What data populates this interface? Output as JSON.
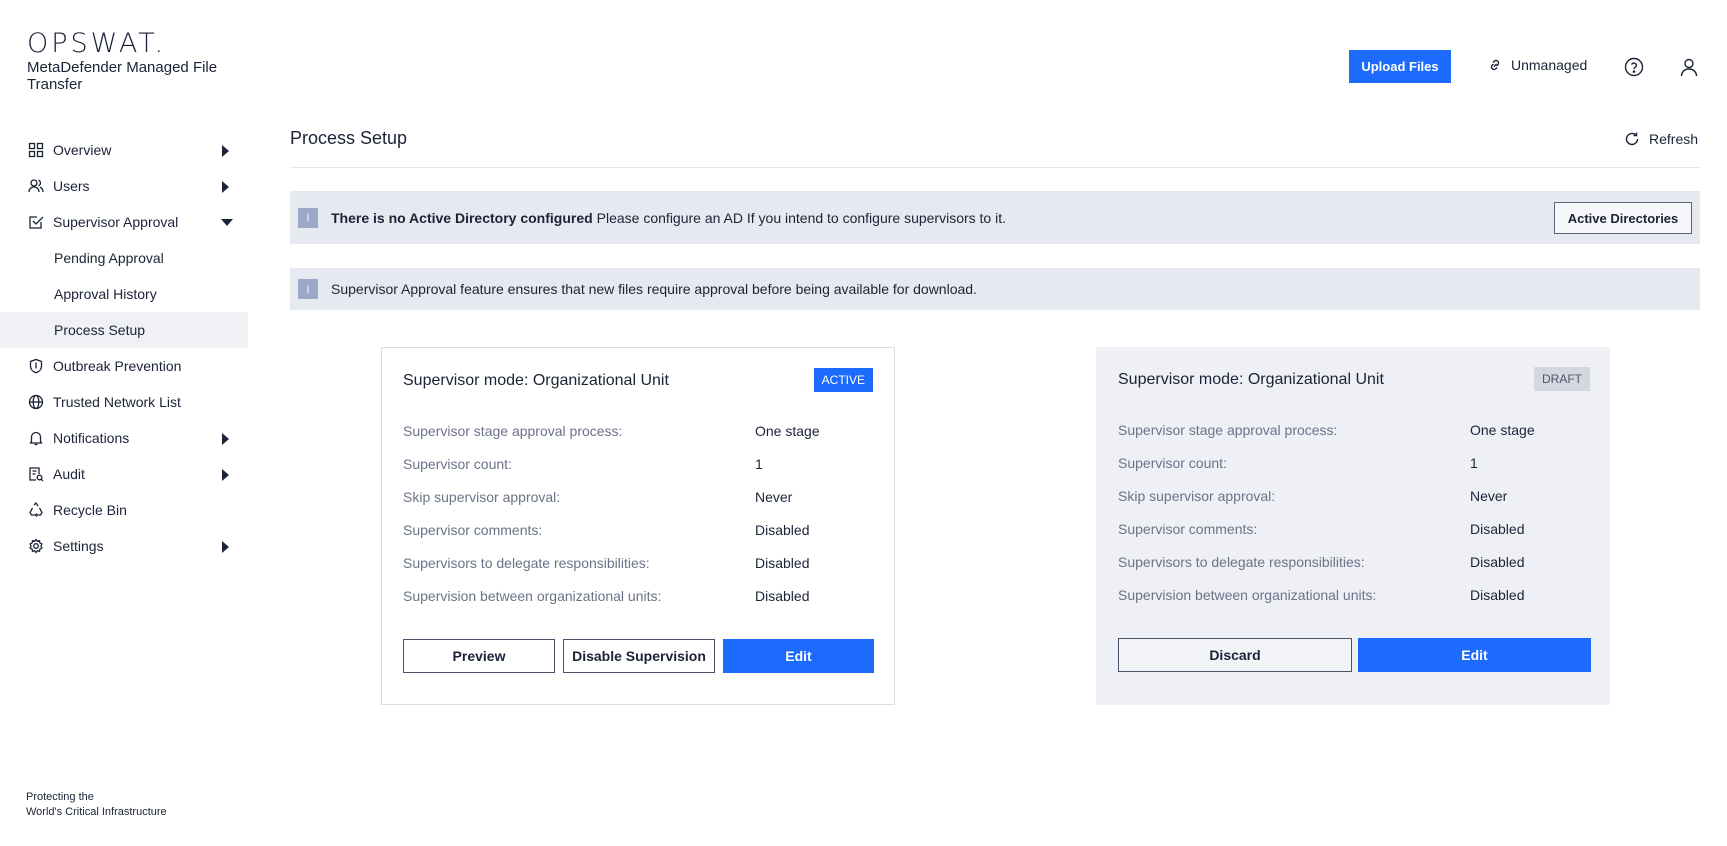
{
  "brand": {
    "logo": "OPSWAT.",
    "product": "MetaDefender Managed File Transfer",
    "footer_line1": "Protecting the",
    "footer_line2": "World's Critical Infrastructure"
  },
  "sidebar": {
    "items": [
      {
        "label": "Overview",
        "icon": "grid-icon"
      },
      {
        "label": "Users",
        "icon": "users-icon"
      },
      {
        "label": "Supervisor Approval",
        "icon": "approval-check-icon"
      },
      {
        "label": "Pending Approval"
      },
      {
        "label": "Approval History"
      },
      {
        "label": "Process Setup"
      },
      {
        "label": "Outbreak Prevention",
        "icon": "shield-icon"
      },
      {
        "label": "Trusted Network List",
        "icon": "globe-icon"
      },
      {
        "label": "Notifications",
        "icon": "bell-icon"
      },
      {
        "label": "Audit",
        "icon": "audit-icon"
      },
      {
        "label": "Recycle Bin",
        "icon": "recycle-icon"
      },
      {
        "label": "Settings",
        "icon": "gear-icon"
      }
    ]
  },
  "topbar": {
    "upload_label": "Upload Files",
    "unmanaged_label": "Unmanaged"
  },
  "main": {
    "title": "Process Setup",
    "refresh_label": "Refresh",
    "banner1": {
      "bold": "There is no Active Directory configured",
      "text": "Please configure an AD If you intend to configure supervisors to it.",
      "button": "Active Directories"
    },
    "banner2": {
      "text": "Supervisor Approval feature ensures that new files require approval before being available for download."
    }
  },
  "cards": [
    {
      "title": "Supervisor mode: Organizational Unit",
      "badge": "ACTIVE",
      "rows": [
        {
          "label": "Supervisor stage approval process:",
          "value": "One stage"
        },
        {
          "label": "Supervisor count:",
          "value": "1"
        },
        {
          "label": "Skip supervisor approval:",
          "value": "Never"
        },
        {
          "label": "Supervisor comments:",
          "value": "Disabled"
        },
        {
          "label": "Supervisors to delegate responsibilities:",
          "value": "Disabled"
        },
        {
          "label": "Supervision between organizational units:",
          "value": "Disabled"
        }
      ],
      "buttons": {
        "preview": "Preview",
        "disable": "Disable Supervision",
        "edit": "Edit"
      }
    },
    {
      "title": "Supervisor mode: Organizational Unit",
      "badge": "DRAFT",
      "rows": [
        {
          "label": "Supervisor stage approval process:",
          "value": "One stage"
        },
        {
          "label": "Supervisor count:",
          "value": "1"
        },
        {
          "label": "Skip supervisor approval:",
          "value": "Never"
        },
        {
          "label": "Supervisor comments:",
          "value": "Disabled"
        },
        {
          "label": "Supervisors to delegate responsibilities:",
          "value": "Disabled"
        },
        {
          "label": "Supervision between organizational units:",
          "value": "Disabled"
        }
      ],
      "buttons": {
        "discard": "Discard",
        "edit": "Edit"
      }
    }
  ],
  "colors": {
    "accent": "#1d6bfc",
    "banner_bg": "#e7e9f1",
    "info_icon": "#9aa8c9",
    "draft_bg": "#eef0f6"
  }
}
